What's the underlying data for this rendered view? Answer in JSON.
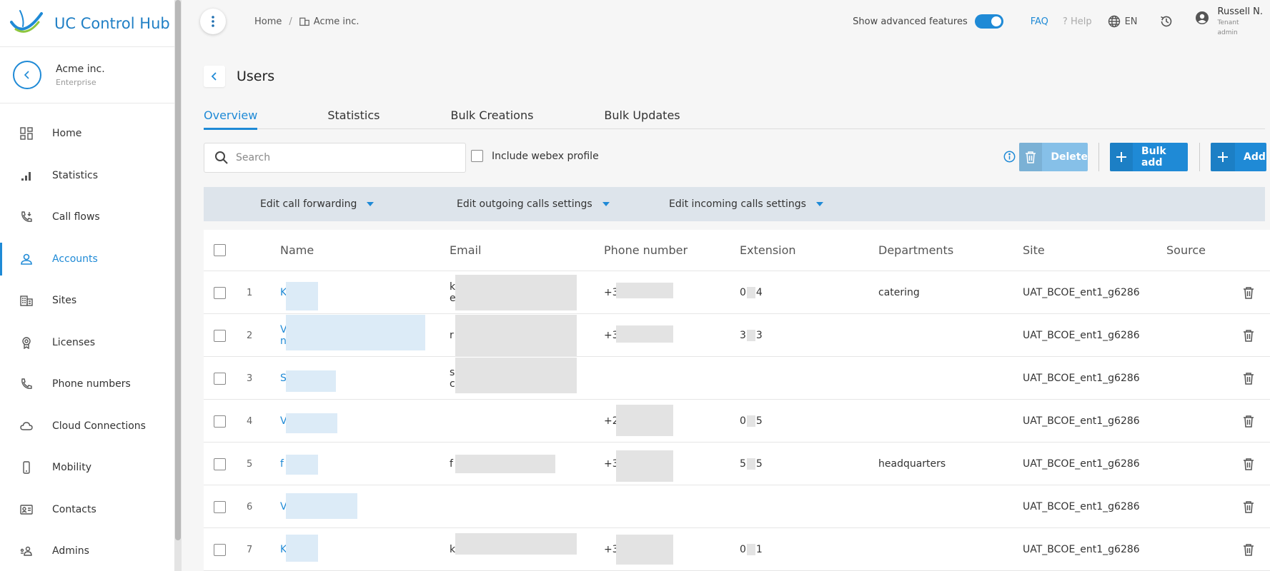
{
  "app": {
    "title": "UC Control Hub"
  },
  "tenant": {
    "name": "Acme inc.",
    "type": "Enterprise"
  },
  "sidebar": {
    "items": [
      {
        "label": "Home",
        "icon": "dashboard-icon",
        "active": false
      },
      {
        "label": "Statistics",
        "icon": "bar-chart-icon",
        "active": false
      },
      {
        "label": "Call flows",
        "icon": "call-flow-icon",
        "active": false
      },
      {
        "label": "Accounts",
        "icon": "person-icon",
        "active": true
      },
      {
        "label": "Sites",
        "icon": "building-icon",
        "active": false
      },
      {
        "label": "Licenses",
        "icon": "badge-icon",
        "active": false
      },
      {
        "label": "Phone numbers",
        "icon": "phone-icon",
        "active": false
      },
      {
        "label": "Cloud Connections",
        "icon": "cloud-icon",
        "active": false
      },
      {
        "label": "Mobility",
        "icon": "mobile-icon",
        "active": false
      },
      {
        "label": "Contacts",
        "icon": "contact-card-icon",
        "active": false
      },
      {
        "label": "Admins",
        "icon": "admin-icon",
        "active": false
      }
    ]
  },
  "topbar": {
    "breadcrumb": [
      "Home",
      "Acme inc."
    ],
    "advanced_label": "Show advanced features",
    "advanced_enabled": true,
    "faq": "FAQ",
    "help": "? Help",
    "language": "EN",
    "user_name": "Russell N.",
    "user_role_line1": "Tenant",
    "user_role_line2": "admin"
  },
  "page": {
    "title": "Users"
  },
  "tabs": [
    {
      "label": "Overview",
      "active": true
    },
    {
      "label": "Statistics",
      "active": false
    },
    {
      "label": "Bulk Creations",
      "active": false
    },
    {
      "label": "Bulk Updates",
      "active": false
    }
  ],
  "toolbar": {
    "search_placeholder": "Search",
    "search_value": "",
    "webex_label": "Include webex profile",
    "delete_label": "Delete",
    "bulk_add_label": "Bulk add",
    "add_label": "Add"
  },
  "bulk_actions": [
    "Edit call forwarding",
    "Edit outgoing calls settings",
    "Edit incoming calls settings"
  ],
  "table": {
    "columns": [
      "Name",
      "Email",
      "Phone number",
      "Extension",
      "Departments",
      "Site",
      "Source"
    ],
    "rows": [
      {
        "index": "1",
        "name": "K",
        "email": "k",
        "email2": "e",
        "phone": "+3",
        "ext_a": "0",
        "ext_b": "4",
        "department": "catering",
        "site": "UAT_BCOE_ent1_g6286"
      },
      {
        "index": "2",
        "name": "V",
        "name2": "n",
        "email": "r",
        "email2": "",
        "phone": "+3",
        "ext_a": "3",
        "ext_b": "3",
        "department": "",
        "site": "UAT_BCOE_ent1_g6286"
      },
      {
        "index": "3",
        "name": "S",
        "email": "s",
        "email2": "c",
        "phone": "",
        "ext_a": "",
        "ext_b": "",
        "department": "",
        "site": "UAT_BCOE_ent1_g6286"
      },
      {
        "index": "4",
        "name": "V",
        "email": "",
        "email2": "",
        "phone": "+2",
        "ext_a": "0",
        "ext_b": "5",
        "department": "",
        "site": "UAT_BCOE_ent1_g6286"
      },
      {
        "index": "5",
        "name": "f",
        "email": "f",
        "email2": "",
        "phone": "+3",
        "ext_a": "5",
        "ext_b": "5",
        "department": "headquarters",
        "site": "UAT_BCOE_ent1_g6286"
      },
      {
        "index": "6",
        "name": "V",
        "email": "",
        "email2": "",
        "phone": "",
        "ext_a": "",
        "ext_b": "",
        "department": "",
        "site": "UAT_BCOE_ent1_g6286"
      },
      {
        "index": "7",
        "name": "K",
        "email": "k",
        "email2": "",
        "phone": "+3",
        "ext_a": "0",
        "ext_b": "1",
        "department": "",
        "site": "UAT_BCOE_ent1_g6286"
      }
    ]
  },
  "colors": {
    "accent": "#1f8ad6",
    "delete_disabled": "#86c0e8",
    "action_bar": "#dde4eb"
  }
}
